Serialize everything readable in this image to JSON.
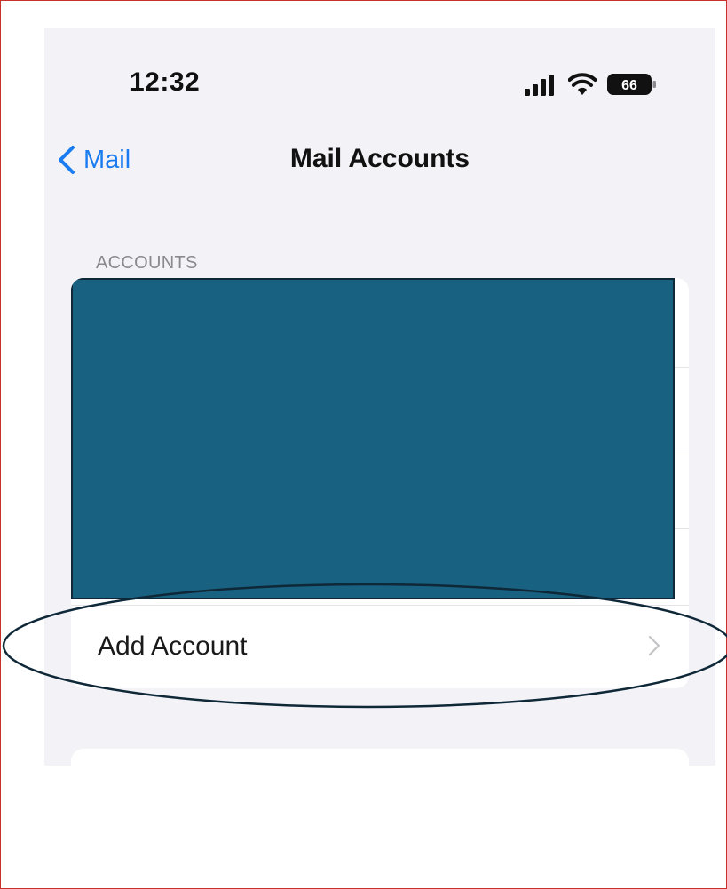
{
  "status_bar": {
    "time": "12:32",
    "battery_level": "66",
    "icons": [
      "cellular-signal-icon",
      "wifi-icon",
      "battery-icon"
    ]
  },
  "nav": {
    "back_label": "Mail",
    "title": "Mail Accounts"
  },
  "accounts_section": {
    "header": "ACCOUNTS",
    "add_account_label": "Add Account"
  },
  "colors": {
    "accent": "#1a7cf0",
    "background": "#f2f2f7",
    "redaction": "#196180",
    "annotation": "#0e2838",
    "frame_border": "#c8312b"
  }
}
